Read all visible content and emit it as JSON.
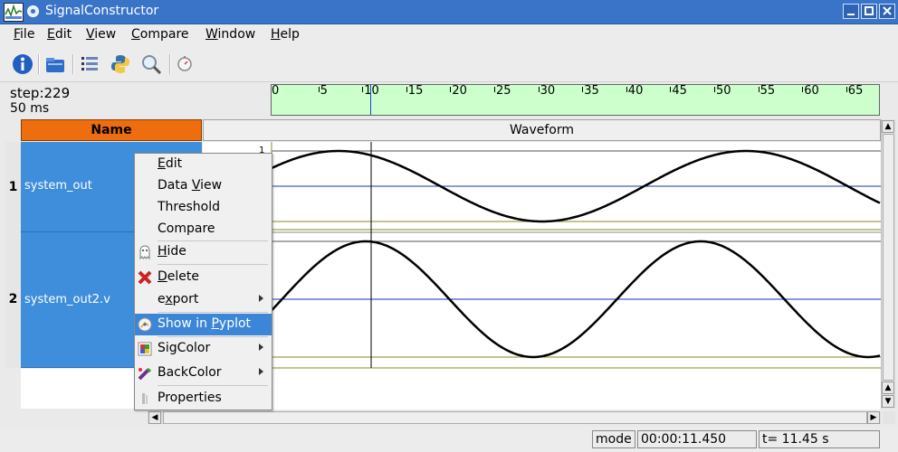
{
  "window": {
    "title": "SignalConstructor"
  },
  "menubar": [
    {
      "label": "File",
      "mnemonic": "F",
      "rest": "ile"
    },
    {
      "label": "Edit",
      "mnemonic": "E",
      "rest": "dit"
    },
    {
      "label": "View",
      "mnemonic": "V",
      "rest": "iew"
    },
    {
      "label": "Compare",
      "mnemonic": "C",
      "rest": "ompare"
    },
    {
      "label": "Window",
      "mnemonic": "W",
      "rest": "indow"
    },
    {
      "label": "Help",
      "mnemonic": "H",
      "rest": "elp"
    }
  ],
  "toolbar": {
    "icons": [
      "info-icon",
      "folder-open-icon",
      "list-icon",
      "python-icon",
      "magnifier-icon",
      "clock-icon"
    ]
  },
  "step": {
    "label": "step:229",
    "interval": "50 ms"
  },
  "ruler": {
    "ticks": [
      "0",
      "5",
      "10",
      "15",
      "20",
      "25",
      "30",
      "35",
      "40",
      "45",
      "50",
      "55",
      "60",
      "65"
    ]
  },
  "columns": {
    "name": "Name",
    "waveform": "Waveform"
  },
  "signals": [
    {
      "num": "1",
      "name": "system_out"
    },
    {
      "num": "2",
      "name": "system_out2.v"
    }
  ],
  "waveform": {
    "y_label": "1"
  },
  "context_menu": {
    "items": [
      {
        "label": "Edit",
        "mn": "E",
        "rest": "dit"
      },
      {
        "label": "Data View",
        "pre": "Data ",
        "mn": "V",
        "rest": "iew"
      },
      {
        "label": "Threshold"
      },
      {
        "label": "Compare"
      },
      {
        "label": "Hide",
        "mn": "H",
        "rest": "ide"
      },
      {
        "label": "Delete",
        "mn": "D",
        "rest": "elete"
      },
      {
        "label": "export",
        "pre": "e",
        "mn": "x",
        "rest": "port"
      },
      {
        "label": "Show in Pyplot",
        "pre": "Show in ",
        "mn": "P",
        "rest": "yplot"
      },
      {
        "label": "SigColor"
      },
      {
        "label": "BackColor"
      },
      {
        "label": "Properties"
      }
    ]
  },
  "status": {
    "mode": "mode",
    "time": "00:00:11.450",
    "t": "t= 11.45 s"
  },
  "colors": {
    "title_bar": "#3a74c8",
    "name_header": "#ee6d0e",
    "signal_row": "#3f8edb",
    "ruler_bg": "#ccffcc",
    "menu_highlight": "#3c86d8"
  }
}
